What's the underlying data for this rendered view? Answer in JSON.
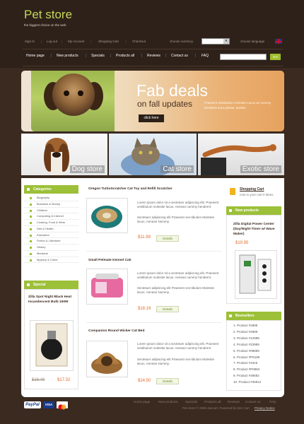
{
  "header": {
    "logo": "Pet store",
    "tagline": "the biggest choice on the web",
    "toplinks": [
      "Sign In",
      "Log out",
      "My Account",
      "Shopping Cart",
      "Checkout"
    ],
    "currency_label": "choose currency",
    "language_label": "choose language"
  },
  "nav": {
    "items": [
      "Home page",
      "New products",
      "Specials",
      "Products all",
      "Reviews",
      "Contact us",
      "FAQ"
    ],
    "go": "Go!"
  },
  "banner": {
    "title": "Fab deals",
    "subtitle": "on fall updates",
    "text": "Praesent vestibulum molestie Lacus an nommy hendrerit auris phase. aseilus",
    "button": "click here"
  },
  "stores": [
    "Dog store",
    "Cat store",
    "Exotic store"
  ],
  "categories": {
    "title": "Categories",
    "items": [
      "Biography",
      "Business & Money",
      "Children",
      "Computing & Internet",
      "Cooking, Food & Wine",
      "Diet & Health",
      "Education",
      "Fiction & Literature",
      "History",
      "Medicine",
      "Mystery & Crime"
    ]
  },
  "special": {
    "title": "Special",
    "product": "Zilla Spot Night Black Heat Incandescent Bulb 150W",
    "old_price": "$19.49",
    "price": "$17.32"
  },
  "products": [
    {
      "title": "Oregon TurboScratcher Cat Toy and Refill Scratcher",
      "desc1": "Lorem ipsum dolor sit a sectetuer adipiscing elit. Praesent vestibulum molestie lacus. Aenean nummy hendrerit",
      "desc2": "Sectetuer adipiscing elit Praesent ves-tibulum Molestie lacus. Aenean Nummy.",
      "price": "$11.99",
      "btn": "Details"
    },
    {
      "title": "Small Petmate Kennel Cab",
      "desc1": "Lorem ipsum dolor sit a sectetuer adipiscing elit. Praesent vestibulum molestie lacus. Aenean nummy hendrerit",
      "desc2": "Sectetuer adipiscing elit Praesent ves-tibulum Molestie lacus. Aenean Nummy.",
      "price": "$18.19",
      "btn": "Details"
    },
    {
      "title": "Companion Round Wicker Cat Bed",
      "desc1": "Lorem ipsum dolor sit a sectetuer adipiscing elit. Praesent vestibulum molestie lacus. Aenean nummy hendrerit",
      "desc2": "Sectetuer adipiscing elit Praesent ves-tibulum Molestie lacus. Aenean Nummy.",
      "price": "$24.50",
      "btn": "Details"
    }
  ],
  "cart": {
    "title": "Shopping Cart",
    "text": "now in your cart 0 items"
  },
  "new_products": {
    "title": "New products",
    "product": "Zilla Digital Power Center (Day/Night-Timer w/ Wave Maker)",
    "price": "$19.95"
  },
  "bestsellers": {
    "title": "Bestsellers",
    "items": [
      "1. Product #2989",
      "2. Product #2989",
      "3. Product #12989",
      "4. Product #23989",
      "5. Product #09859",
      "6. Product #P5189",
      "7. Product #1916",
      "8. Product #P6984",
      "9. Product #49582",
      "10. Product #45812"
    ]
  },
  "footer": {
    "links": [
      "Home page",
      "New products",
      "Specials",
      "Products all",
      "Reviews",
      "Contact us",
      "FAQ"
    ],
    "copyright": "Pet store © 2008 Jancart. Powered by Zen Cart",
    "privacy": "Privacy Notice",
    "paypal": "PayPal",
    "visa": "VISA"
  }
}
